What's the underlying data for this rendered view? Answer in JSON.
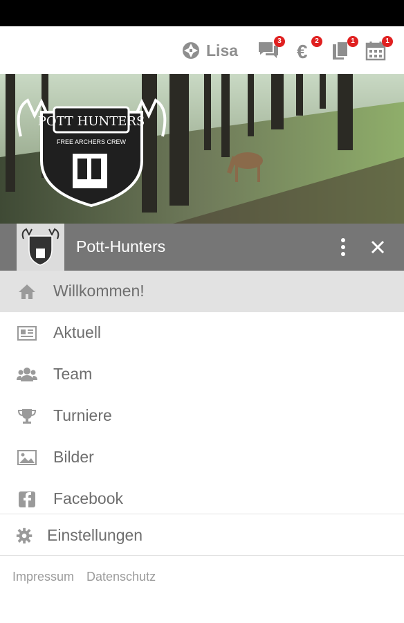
{
  "header": {
    "user_name": "Lisa",
    "icons": [
      {
        "name": "chat-icon",
        "badge": "3"
      },
      {
        "name": "euro-icon",
        "badge": "2"
      },
      {
        "name": "documents-icon",
        "badge": "1"
      },
      {
        "name": "calendar-icon",
        "badge": "1"
      }
    ]
  },
  "hero": {
    "logo_text_top": "POTT HUNTERS",
    "logo_text_bottom": "FREE ARCHERS CREW"
  },
  "club": {
    "name": "Pott-Hunters"
  },
  "menu": {
    "items": [
      {
        "label": "Willkommen!",
        "icon": "home-icon",
        "active": true
      },
      {
        "label": "Aktuell",
        "icon": "newspaper-icon",
        "active": false
      },
      {
        "label": "Team",
        "icon": "users-icon",
        "active": false
      },
      {
        "label": "Turniere",
        "icon": "trophy-icon",
        "active": false
      },
      {
        "label": "Bilder",
        "icon": "image-icon",
        "active": false
      },
      {
        "label": "Facebook",
        "icon": "facebook-icon",
        "active": false
      }
    ],
    "settings_label": "Einstellungen"
  },
  "footer": {
    "impressum": "Impressum",
    "datenschutz": "Datenschutz"
  },
  "colors": {
    "accent_badge": "#e02020",
    "club_bar": "#767676",
    "active_item": "#e2e2e2"
  }
}
